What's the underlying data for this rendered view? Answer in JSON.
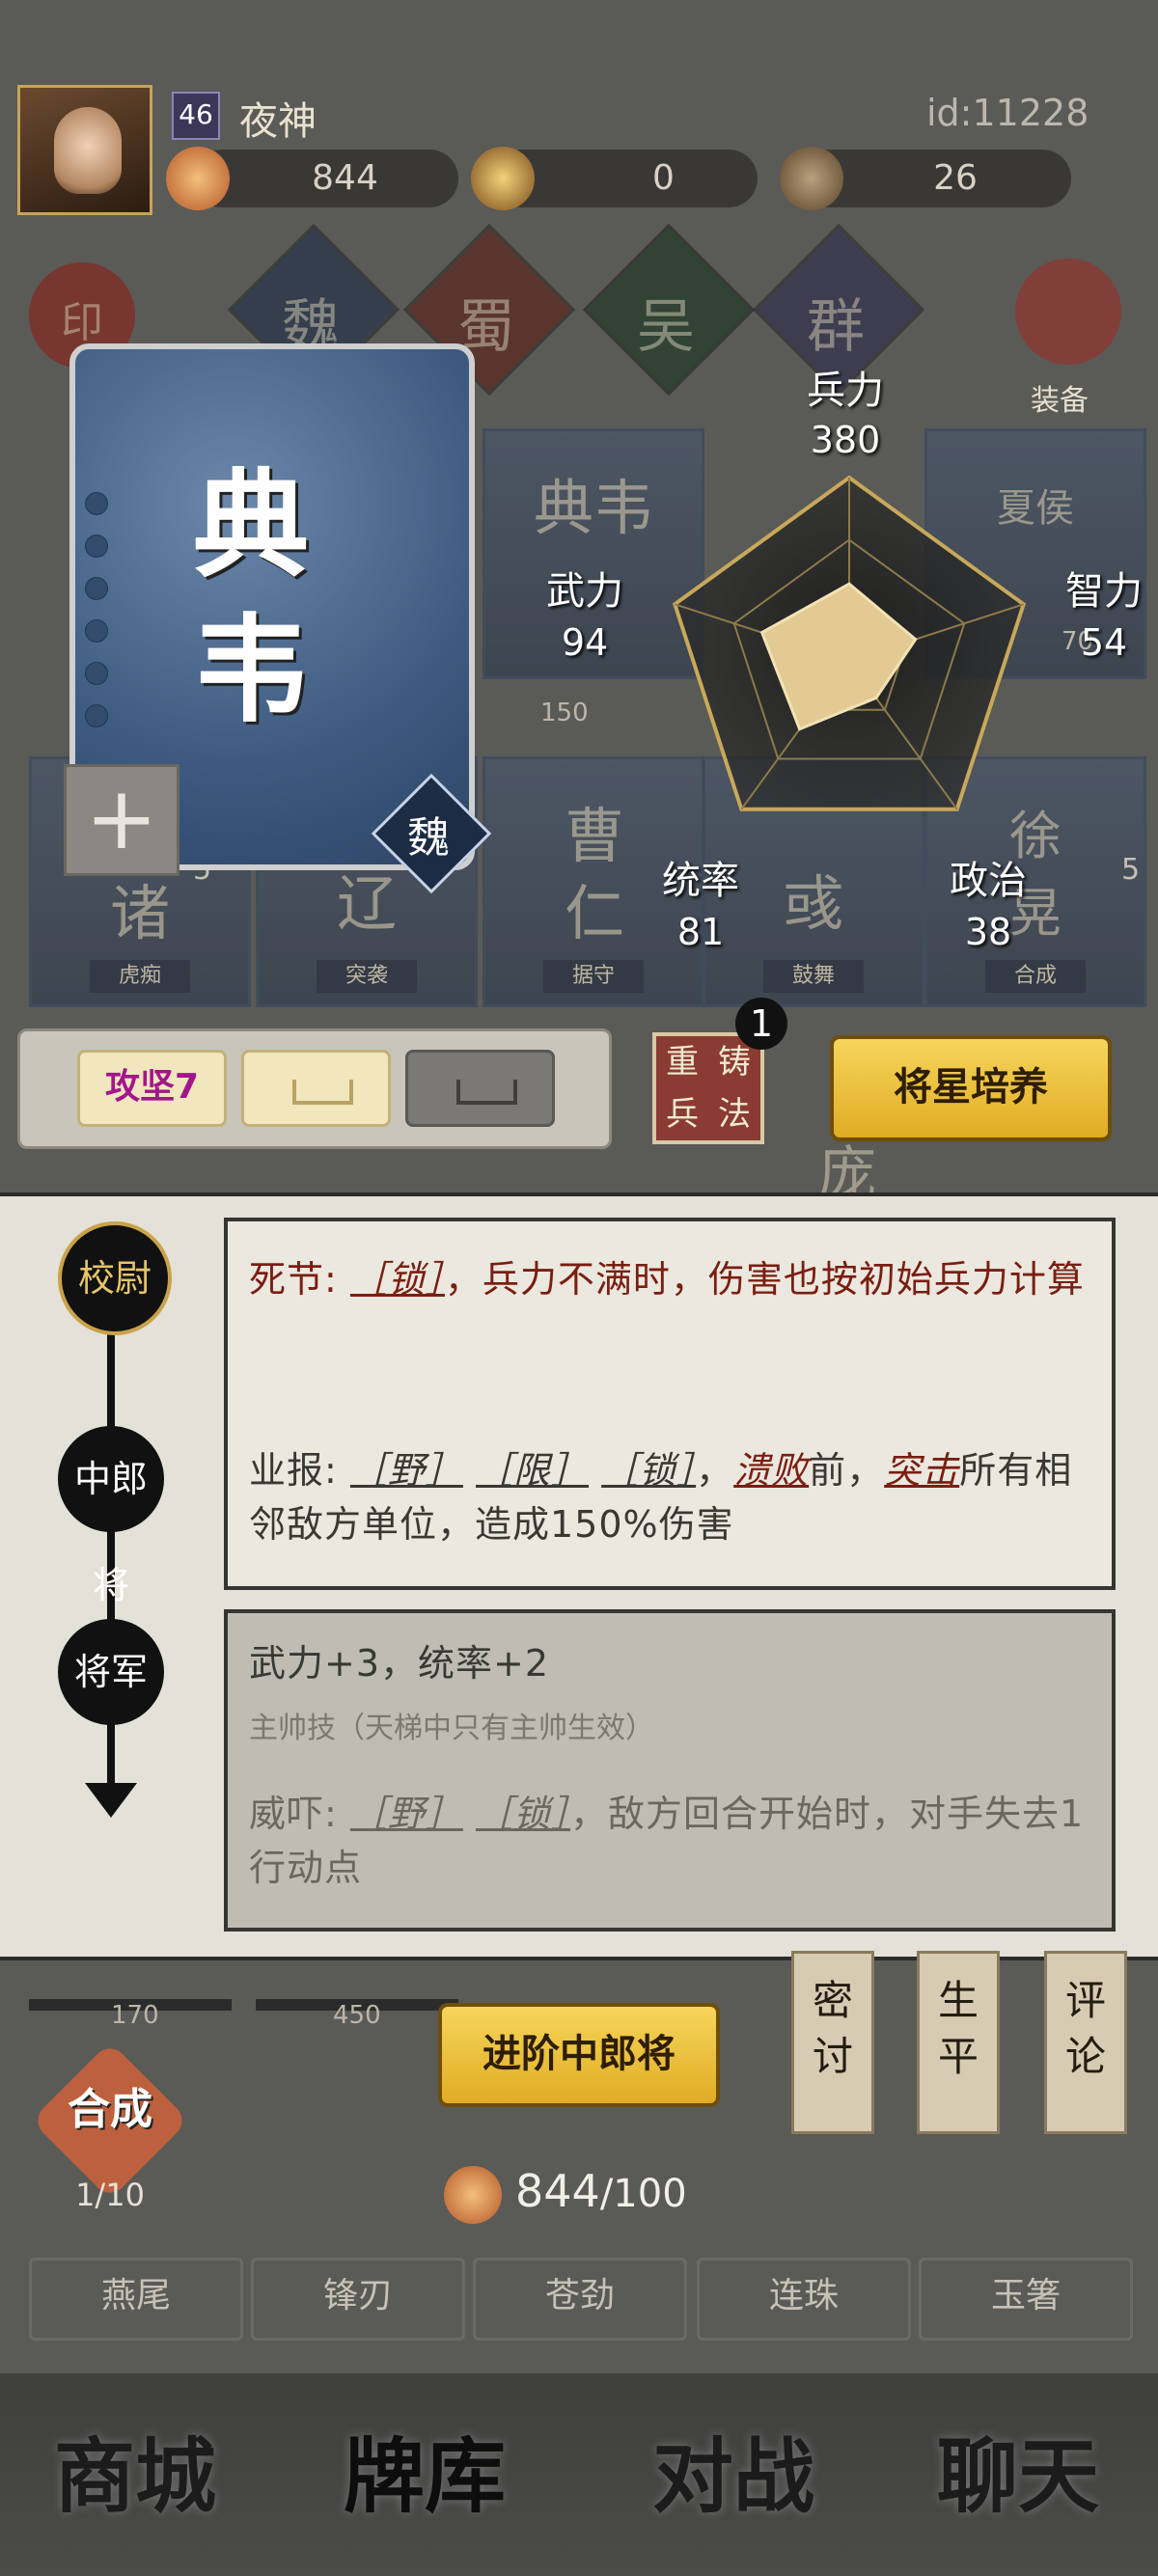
{
  "player": {
    "level": "46",
    "name": "夜神",
    "id": "id:11228"
  },
  "resources": [
    {
      "icon": "crossed-swords-coin-icon",
      "value": "844"
    },
    {
      "icon": "general-token-icon",
      "value": "0"
    },
    {
      "icon": "pouch-icon",
      "value": "26"
    }
  ],
  "factions": [
    {
      "label": "印",
      "name": "seal"
    },
    {
      "label": "魏"
    },
    {
      "label": "蜀"
    },
    {
      "label": "吴"
    },
    {
      "label": "群"
    },
    {
      "label": "装备"
    }
  ],
  "background_cards": {
    "row1": [
      {
        "name": "典韦",
        "level": "150"
      },
      {
        "name": "夏侯",
        "level": "70"
      }
    ],
    "row2": [
      {
        "name": "诸",
        "tag": "虎痴",
        "level": "5"
      },
      {
        "name": "辽",
        "tag": "突袭"
      },
      {
        "name": "曹仁",
        "tag": "据守"
      },
      {
        "name": "彧",
        "tag": "鼓舞"
      },
      {
        "name": "徐晃",
        "tag": "合成",
        "level": "5"
      }
    ],
    "row3": [
      {
        "name": "庞"
      }
    ],
    "bottom_levels": [
      "170",
      "450"
    ]
  },
  "hero": {
    "name": "典韦",
    "faction": "魏",
    "plus": "+"
  },
  "stats": {
    "bingli": {
      "label": "兵力",
      "value": "380"
    },
    "zhili": {
      "label": "智力",
      "value": "54"
    },
    "zhengzhi": {
      "label": "政治",
      "value": "38"
    },
    "tongshuai": {
      "label": "统率",
      "value": "81"
    },
    "wuli": {
      "label": "武力",
      "value": "94"
    },
    "radar_fraction": {
      "bingli": 0.42,
      "zhili": 0.38,
      "zhengzhi": 0.25,
      "tongshuai": 0.46,
      "wuli": 0.5
    }
  },
  "tactics": {
    "slot1": "攻坚7",
    "recast": [
      "重",
      "铸",
      "兵",
      "法"
    ],
    "recast_badge": "1",
    "cultivate": "将星培养"
  },
  "ranks": [
    "校尉",
    "中郎将",
    "将军"
  ],
  "skills": {
    "s1": {
      "title": "死节:",
      "tag": "［锁］",
      "rest": "，兵力不满时，伤害也按初始兵力计算"
    },
    "s2": {
      "title": "业报:",
      "tags": [
        "［野］",
        "［限］",
        "［锁］"
      ],
      "mid": "，",
      "link1": "溃败",
      "mid2": "前，",
      "link2": "突击",
      "rest": "所有相邻敌方单位，造成150%伤害"
    },
    "s3": {
      "title": "武力+3，统率+2",
      "note": "主帅技（天梯中只有主帅生效）"
    },
    "s4": {
      "title": "威吓:",
      "tags": [
        "［野］",
        "［锁］"
      ],
      "rest": "，敌方回合开始时，对手失去1行动点"
    }
  },
  "actions": {
    "advance": "进阶中郎将",
    "merge": "合成",
    "merge_count": "1/10",
    "cost_current": "844",
    "cost_required": "/100"
  },
  "side_buttons": [
    {
      "chars": [
        "密",
        "讨"
      ]
    },
    {
      "chars": [
        "生",
        "平"
      ]
    },
    {
      "chars": [
        "评",
        "论"
      ]
    }
  ],
  "shards": [
    "燕尾",
    "锋刃",
    "苍劲",
    "连珠",
    "玉箸"
  ],
  "nav": [
    "商城",
    "牌库",
    "对战",
    "聊天"
  ],
  "colors": {
    "gold": "#e8b82e",
    "panel": "#e4e1d8",
    "crimson": "#7a1e12",
    "card_blue": "#3d5a80"
  }
}
